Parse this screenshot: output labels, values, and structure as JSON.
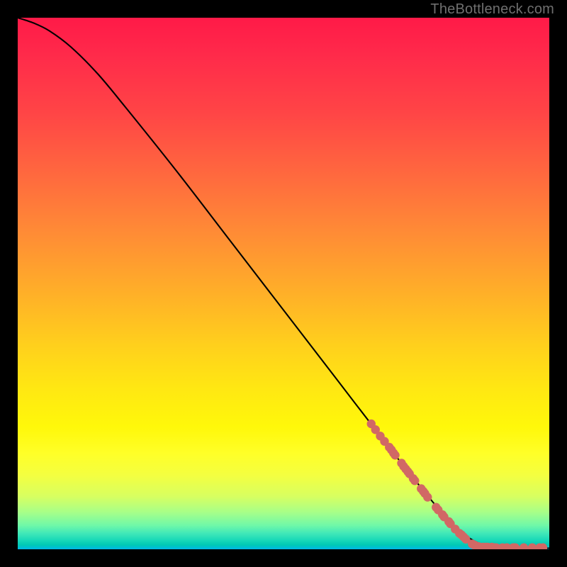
{
  "attribution": "TheBottleneck.com",
  "chart_data": {
    "type": "line",
    "title": "",
    "xlabel": "",
    "ylabel": "",
    "xlim": [
      0,
      100
    ],
    "ylim": [
      0,
      100
    ],
    "grid": false,
    "legend": false,
    "curve_note": "Main curve is a monotonically decreasing bottleneck curve from top-left toward bottom-right, flattening to near-zero at the right.",
    "curve": [
      {
        "x": 0,
        "y": 100
      },
      {
        "x": 3,
        "y": 99
      },
      {
        "x": 6,
        "y": 97.5
      },
      {
        "x": 10,
        "y": 94.5
      },
      {
        "x": 15,
        "y": 89.5
      },
      {
        "x": 20,
        "y": 83.5
      },
      {
        "x": 30,
        "y": 71
      },
      {
        "x": 40,
        "y": 58
      },
      {
        "x": 50,
        "y": 45
      },
      {
        "x": 60,
        "y": 32
      },
      {
        "x": 70,
        "y": 19
      },
      {
        "x": 78,
        "y": 9
      },
      {
        "x": 82,
        "y": 4.5
      },
      {
        "x": 86,
        "y": 1.5
      },
      {
        "x": 90,
        "y": 0.4
      },
      {
        "x": 100,
        "y": 0.2
      }
    ],
    "series": [
      {
        "name": "markers",
        "type": "scatter",
        "color": "#d16865",
        "points": [
          {
            "x": 66.5,
            "y": 23.6
          },
          {
            "x": 67.3,
            "y": 22.5
          },
          {
            "x": 68.2,
            "y": 21.3
          },
          {
            "x": 69.0,
            "y": 20.3
          },
          {
            "x": 69.9,
            "y": 19.2
          },
          {
            "x": 70.3,
            "y": 18.7
          },
          {
            "x": 70.7,
            "y": 18.1
          },
          {
            "x": 71.0,
            "y": 17.7
          },
          {
            "x": 72.2,
            "y": 16.2
          },
          {
            "x": 72.6,
            "y": 15.6
          },
          {
            "x": 73.0,
            "y": 15.1
          },
          {
            "x": 73.4,
            "y": 14.6
          },
          {
            "x": 73.7,
            "y": 14.2
          },
          {
            "x": 74.4,
            "y": 13.3
          },
          {
            "x": 74.7,
            "y": 12.9
          },
          {
            "x": 75.9,
            "y": 11.4
          },
          {
            "x": 76.3,
            "y": 10.9
          },
          {
            "x": 76.6,
            "y": 10.5
          },
          {
            "x": 77.1,
            "y": 9.8
          },
          {
            "x": 78.7,
            "y": 7.9
          },
          {
            "x": 79.1,
            "y": 7.4
          },
          {
            "x": 79.9,
            "y": 6.5
          },
          {
            "x": 80.2,
            "y": 6.1
          },
          {
            "x": 81.1,
            "y": 5.2
          },
          {
            "x": 81.4,
            "y": 4.8
          },
          {
            "x": 82.3,
            "y": 3.8
          },
          {
            "x": 83.1,
            "y": 3.0
          },
          {
            "x": 83.5,
            "y": 2.7
          },
          {
            "x": 83.9,
            "y": 2.3
          },
          {
            "x": 84.3,
            "y": 1.9
          },
          {
            "x": 85.5,
            "y": 1.0
          },
          {
            "x": 85.9,
            "y": 0.8
          },
          {
            "x": 86.3,
            "y": 0.6
          },
          {
            "x": 86.7,
            "y": 0.5
          },
          {
            "x": 87.5,
            "y": 0.4
          },
          {
            "x": 88.0,
            "y": 0.4
          },
          {
            "x": 88.4,
            "y": 0.4
          },
          {
            "x": 89.2,
            "y": 0.4
          },
          {
            "x": 89.6,
            "y": 0.3
          },
          {
            "x": 90.0,
            "y": 0.3
          },
          {
            "x": 91.2,
            "y": 0.3
          },
          {
            "x": 92.0,
            "y": 0.3
          },
          {
            "x": 93.2,
            "y": 0.3
          },
          {
            "x": 93.6,
            "y": 0.3
          },
          {
            "x": 95.2,
            "y": 0.3
          },
          {
            "x": 96.8,
            "y": 0.3
          },
          {
            "x": 98.2,
            "y": 0.3
          },
          {
            "x": 98.8,
            "y": 0.3
          }
        ]
      }
    ]
  }
}
